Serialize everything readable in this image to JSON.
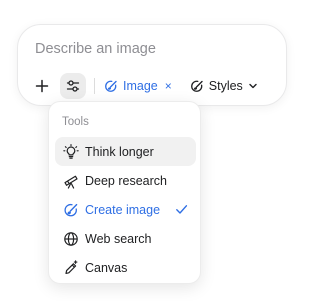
{
  "composer": {
    "placeholder": "Describe an image",
    "plus_icon": "plus-icon",
    "tools_icon": "sliders-icon",
    "image_chip": {
      "label": "Image",
      "icon": "brush-icon",
      "close": "×"
    },
    "styles_chip": {
      "label": "Styles",
      "icon": "palette-icon",
      "chevron": "chevron-down-icon"
    }
  },
  "menu": {
    "header": "Tools",
    "items": [
      {
        "label": "Think longer",
        "icon": "lightbulb-icon",
        "state": "hover"
      },
      {
        "label": "Deep research",
        "icon": "telescope-icon",
        "state": ""
      },
      {
        "label": "Create image",
        "icon": "brush-icon",
        "state": "selected"
      },
      {
        "label": "Web search",
        "icon": "globe-icon",
        "state": ""
      },
      {
        "label": "Canvas",
        "icon": "pencil-sparkle-icon",
        "state": ""
      }
    ]
  },
  "colors": {
    "accent": "#2f6fe4",
    "text": "#202123",
    "muted": "#8e8e93",
    "hover_bg": "#f1f1f1"
  }
}
